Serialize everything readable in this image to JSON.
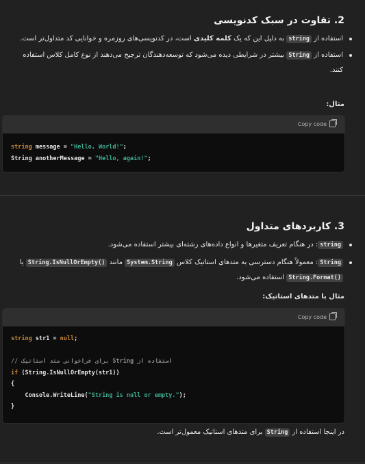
{
  "section2": {
    "title": "2. تفاوت در سبک کدنویسی",
    "bullet1_pre": "استفاده از",
    "bullet1_code": "string",
    "bullet1_mid": "به دلیل این که یک",
    "bullet1_bold": "کلمه کلیدی",
    "bullet1_post": "است، در کدنویسی‌های روزمره و خوانایی کد متداول‌تر است.",
    "bullet2_pre": "استفاده از",
    "bullet2_code": "String",
    "bullet2_post": "بیشتر در شرایطی دیده می‌شود که توسعه‌دهندگان ترجیح می‌دهند از نوع کامل کلاس استفاده کنند.",
    "example_label": "مثال:",
    "copy_label": "Copy code",
    "code": {
      "l1_type": "string",
      "l1_rest": " message = ",
      "l1_str": "\"Hello, World!\"",
      "l1_end": ";",
      "l2_type": "String",
      "l2_rest": " anotherMessage = ",
      "l2_str": "\"Hello, again!\"",
      "l2_end": ";"
    }
  },
  "section3": {
    "title": "3. کاربردهای متداول",
    "bullet1_code": "string",
    "bullet1_post": ": در هنگام تعریف متغیرها و انواع داده‌های رشته‌ای بیشتر استفاده می‌شود.",
    "bullet2_code": "String",
    "bullet2_mid": ": معمولاً هنگام دسترسی به متدهای استاتیک کلاس",
    "bullet2_code2": "System.String",
    "bullet2_mid2": "مانند",
    "bullet2_code3": "String.IsNullOrEmpty()",
    "bullet2_or": "یا",
    "bullet2_code4": "String.Format()",
    "bullet2_post": "استفاده می‌شود.",
    "example_label": "مثال با متدهای استاتیک:",
    "copy_label": "Copy code",
    "code": {
      "l1_type": "string",
      "l1_rest": " str1 = ",
      "l1_null": "null",
      "l1_end": ";",
      "l2_comment": "// برای فراخوانی متد استاتیک String استفاده از",
      "l3_kw": "if",
      "l3_rest": " (String.IsNullOrEmpty(str1))",
      "l4": "{",
      "l5_pre": "    Console.WriteLine(",
      "l5_str": "\"String is null or empty.\"",
      "l5_end": ");",
      "l6": "}"
    },
    "closing_pre": "در اینجا استفاده از",
    "closing_code": "String",
    "closing_post": "برای متدهای استاتیک معمول‌تر است."
  }
}
